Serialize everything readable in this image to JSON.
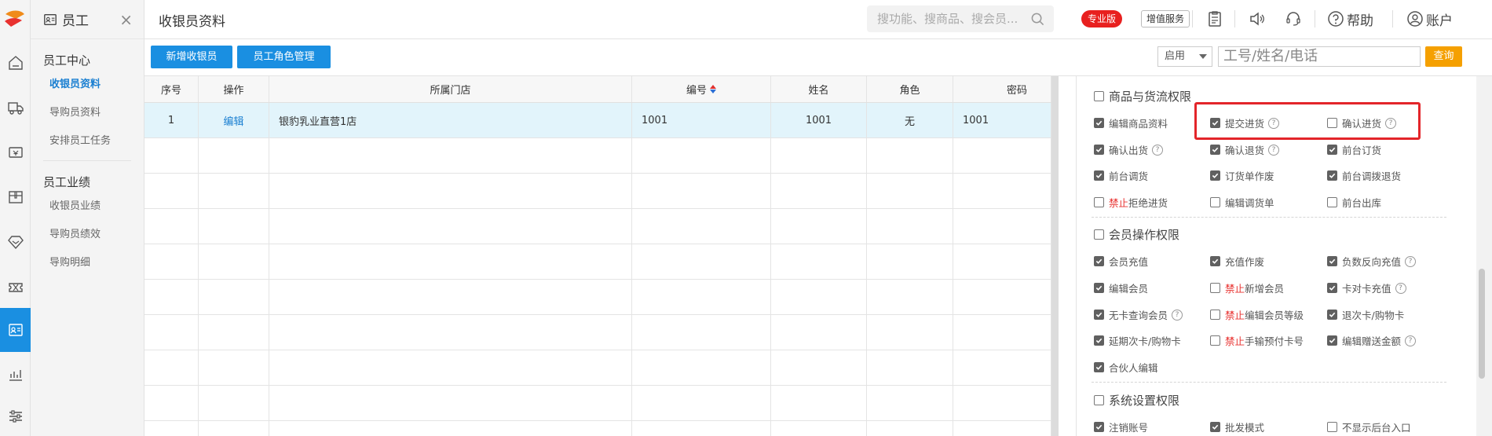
{
  "nav": {
    "header": "员工",
    "groups": [
      {
        "title": "员工中心",
        "items": [
          "收银员资料",
          "导购员资料",
          "安排员工任务"
        ]
      },
      {
        "title": "员工业绩",
        "items": [
          "收银员业绩",
          "导购员绩效",
          "导购明细"
        ]
      }
    ]
  },
  "topbar": {
    "page_title": "收银员资料",
    "search_placeholder": "搜功能、搜商品、搜会员...",
    "pro_badge": "专业版",
    "value_added": "增值服务",
    "help": "帮助",
    "account": "账户"
  },
  "toolbar": {
    "add_cashier": "新增收银员",
    "role_manage": "员工角色管理",
    "status_select": "启用",
    "keyword_placeholder": "工号/姓名/电话",
    "query": "查询"
  },
  "table": {
    "headers": [
      "序号",
      "操作",
      "所属门店",
      "编号",
      "姓名",
      "角色",
      "密码"
    ],
    "rows": [
      {
        "no": "1",
        "action": "编辑",
        "store": "银豹乳业直营1店",
        "code": "1001",
        "name": "1001",
        "role": "无",
        "password": "1001"
      }
    ]
  },
  "permissions": {
    "sections": [
      {
        "title": "商品与货流权限",
        "items": [
          {
            "label": "编辑商品资料",
            "checked": true
          },
          {
            "label": "提交进货",
            "checked": true,
            "help": true
          },
          {
            "label": "确认进货",
            "checked": false,
            "help": true
          },
          {
            "label": "确认出货",
            "checked": true,
            "help": true
          },
          {
            "label": "确认退货",
            "checked": true,
            "help": true
          },
          {
            "label": "前台订货",
            "checked": true
          },
          {
            "label": "前台调货",
            "checked": true
          },
          {
            "label": "订货单作废",
            "checked": true
          },
          {
            "label": "前台调拨退货",
            "checked": true
          },
          {
            "prefix": "禁止",
            "label": "拒绝进货",
            "checked": false
          },
          {
            "label": "编辑调货单",
            "checked": false
          },
          {
            "label": "前台出库",
            "checked": false
          }
        ]
      },
      {
        "title": "会员操作权限",
        "items": [
          {
            "label": "会员充值",
            "checked": true
          },
          {
            "label": "充值作废",
            "checked": true
          },
          {
            "label": "负数反向充值",
            "checked": true,
            "help": true
          },
          {
            "label": "编辑会员",
            "checked": true
          },
          {
            "prefix": "禁止",
            "label": "新增会员",
            "checked": false
          },
          {
            "label": "卡对卡充值",
            "checked": true,
            "help": true
          },
          {
            "label": "无卡查询会员",
            "checked": true,
            "help": true
          },
          {
            "prefix": "禁止",
            "label": "编辑会员等级",
            "checked": false
          },
          {
            "label": "退次卡/购物卡",
            "checked": true
          },
          {
            "label": "延期次卡/购物卡",
            "checked": true
          },
          {
            "prefix": "禁止",
            "label": "手输预付卡号",
            "checked": false
          },
          {
            "label": "编辑赠送金额",
            "checked": true,
            "help": true
          },
          {
            "label": "合伙人编辑",
            "checked": true
          }
        ]
      },
      {
        "title": "系统设置权限",
        "items": [
          {
            "label": "注销账号",
            "checked": true
          },
          {
            "label": "批发模式",
            "checked": true
          },
          {
            "label": "不显示后台入口",
            "checked": false
          }
        ]
      }
    ]
  },
  "colors": {
    "accent": "#1a8fe1",
    "pro_badge": "#e8201f",
    "query": "#f5a000",
    "highlight_box": "#e3252a",
    "forbid": "#e8312f"
  }
}
